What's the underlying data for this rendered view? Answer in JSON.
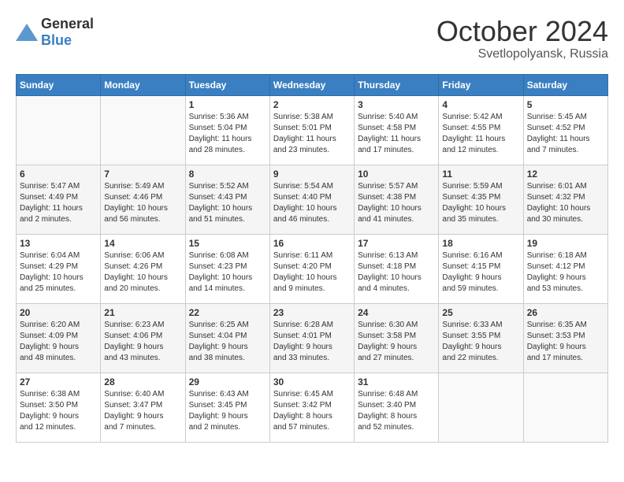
{
  "header": {
    "logo": {
      "general": "General",
      "blue": "Blue"
    },
    "month": "October 2024",
    "location": "Svetlopolyansk, Russia"
  },
  "days_of_week": [
    "Sunday",
    "Monday",
    "Tuesday",
    "Wednesday",
    "Thursday",
    "Friday",
    "Saturday"
  ],
  "weeks": [
    [
      {
        "day": "",
        "content": ""
      },
      {
        "day": "",
        "content": ""
      },
      {
        "day": "1",
        "content": "Sunrise: 5:36 AM\nSunset: 5:04 PM\nDaylight: 11 hours\nand 28 minutes."
      },
      {
        "day": "2",
        "content": "Sunrise: 5:38 AM\nSunset: 5:01 PM\nDaylight: 11 hours\nand 23 minutes."
      },
      {
        "day": "3",
        "content": "Sunrise: 5:40 AM\nSunset: 4:58 PM\nDaylight: 11 hours\nand 17 minutes."
      },
      {
        "day": "4",
        "content": "Sunrise: 5:42 AM\nSunset: 4:55 PM\nDaylight: 11 hours\nand 12 minutes."
      },
      {
        "day": "5",
        "content": "Sunrise: 5:45 AM\nSunset: 4:52 PM\nDaylight: 11 hours\nand 7 minutes."
      }
    ],
    [
      {
        "day": "6",
        "content": "Sunrise: 5:47 AM\nSunset: 4:49 PM\nDaylight: 11 hours\nand 2 minutes."
      },
      {
        "day": "7",
        "content": "Sunrise: 5:49 AM\nSunset: 4:46 PM\nDaylight: 10 hours\nand 56 minutes."
      },
      {
        "day": "8",
        "content": "Sunrise: 5:52 AM\nSunset: 4:43 PM\nDaylight: 10 hours\nand 51 minutes."
      },
      {
        "day": "9",
        "content": "Sunrise: 5:54 AM\nSunset: 4:40 PM\nDaylight: 10 hours\nand 46 minutes."
      },
      {
        "day": "10",
        "content": "Sunrise: 5:57 AM\nSunset: 4:38 PM\nDaylight: 10 hours\nand 41 minutes."
      },
      {
        "day": "11",
        "content": "Sunrise: 5:59 AM\nSunset: 4:35 PM\nDaylight: 10 hours\nand 35 minutes."
      },
      {
        "day": "12",
        "content": "Sunrise: 6:01 AM\nSunset: 4:32 PM\nDaylight: 10 hours\nand 30 minutes."
      }
    ],
    [
      {
        "day": "13",
        "content": "Sunrise: 6:04 AM\nSunset: 4:29 PM\nDaylight: 10 hours\nand 25 minutes."
      },
      {
        "day": "14",
        "content": "Sunrise: 6:06 AM\nSunset: 4:26 PM\nDaylight: 10 hours\nand 20 minutes."
      },
      {
        "day": "15",
        "content": "Sunrise: 6:08 AM\nSunset: 4:23 PM\nDaylight: 10 hours\nand 14 minutes."
      },
      {
        "day": "16",
        "content": "Sunrise: 6:11 AM\nSunset: 4:20 PM\nDaylight: 10 hours\nand 9 minutes."
      },
      {
        "day": "17",
        "content": "Sunrise: 6:13 AM\nSunset: 4:18 PM\nDaylight: 10 hours\nand 4 minutes."
      },
      {
        "day": "18",
        "content": "Sunrise: 6:16 AM\nSunset: 4:15 PM\nDaylight: 9 hours\nand 59 minutes."
      },
      {
        "day": "19",
        "content": "Sunrise: 6:18 AM\nSunset: 4:12 PM\nDaylight: 9 hours\nand 53 minutes."
      }
    ],
    [
      {
        "day": "20",
        "content": "Sunrise: 6:20 AM\nSunset: 4:09 PM\nDaylight: 9 hours\nand 48 minutes."
      },
      {
        "day": "21",
        "content": "Sunrise: 6:23 AM\nSunset: 4:06 PM\nDaylight: 9 hours\nand 43 minutes."
      },
      {
        "day": "22",
        "content": "Sunrise: 6:25 AM\nSunset: 4:04 PM\nDaylight: 9 hours\nand 38 minutes."
      },
      {
        "day": "23",
        "content": "Sunrise: 6:28 AM\nSunset: 4:01 PM\nDaylight: 9 hours\nand 33 minutes."
      },
      {
        "day": "24",
        "content": "Sunrise: 6:30 AM\nSunset: 3:58 PM\nDaylight: 9 hours\nand 27 minutes."
      },
      {
        "day": "25",
        "content": "Sunrise: 6:33 AM\nSunset: 3:55 PM\nDaylight: 9 hours\nand 22 minutes."
      },
      {
        "day": "26",
        "content": "Sunrise: 6:35 AM\nSunset: 3:53 PM\nDaylight: 9 hours\nand 17 minutes."
      }
    ],
    [
      {
        "day": "27",
        "content": "Sunrise: 6:38 AM\nSunset: 3:50 PM\nDaylight: 9 hours\nand 12 minutes."
      },
      {
        "day": "28",
        "content": "Sunrise: 6:40 AM\nSunset: 3:47 PM\nDaylight: 9 hours\nand 7 minutes."
      },
      {
        "day": "29",
        "content": "Sunrise: 6:43 AM\nSunset: 3:45 PM\nDaylight: 9 hours\nand 2 minutes."
      },
      {
        "day": "30",
        "content": "Sunrise: 6:45 AM\nSunset: 3:42 PM\nDaylight: 8 hours\nand 57 minutes."
      },
      {
        "day": "31",
        "content": "Sunrise: 6:48 AM\nSunset: 3:40 PM\nDaylight: 8 hours\nand 52 minutes."
      },
      {
        "day": "",
        "content": ""
      },
      {
        "day": "",
        "content": ""
      }
    ]
  ]
}
